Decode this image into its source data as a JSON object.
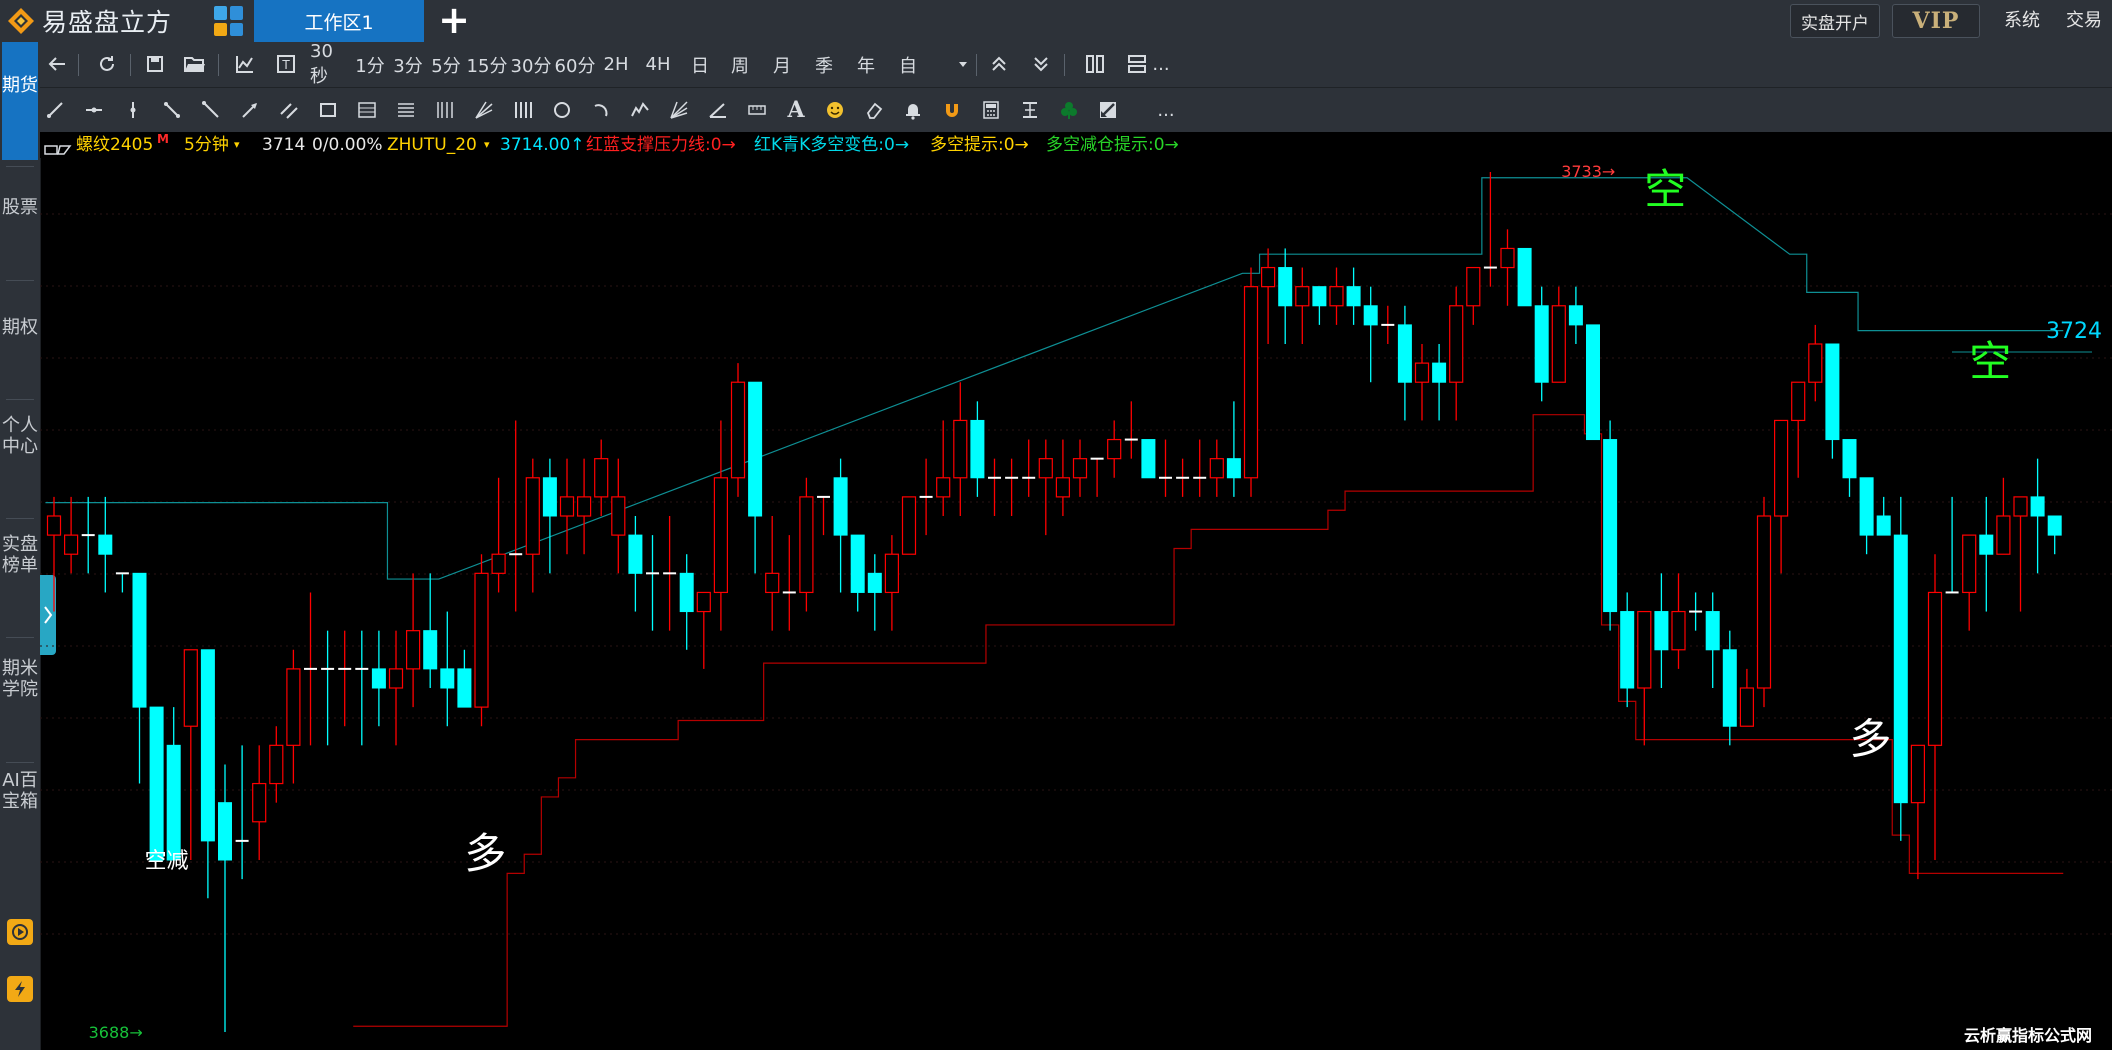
{
  "titlebar": {
    "app_name": "易盛盘立方",
    "workspace_tab": "工作区1",
    "add_tab": "+",
    "open_account": "实盘开户",
    "vip": "VIP",
    "system": "系统",
    "trade": "交易"
  },
  "sidebar": {
    "items": [
      {
        "label": "期货",
        "active": true
      },
      {
        "label": "股票"
      },
      {
        "label": "期权"
      },
      {
        "label": "个人中心"
      },
      {
        "label": "实盘榜单"
      },
      {
        "label": "期米学院"
      },
      {
        "label": "AI百宝箱"
      }
    ]
  },
  "toolbar1": {
    "icons": [
      "back-icon",
      "refresh-icon",
      "save-icon",
      "open-folder-icon",
      "indicator-icon",
      "text-icon"
    ],
    "periods": [
      "30秒",
      "1分",
      "3分",
      "5分",
      "15分",
      "30分",
      "60分",
      "2H",
      "4H",
      "日",
      "周",
      "月",
      "季",
      "年",
      "自"
    ],
    "more": "..."
  },
  "toolbar2": {
    "drawing_tools": [
      "line-icon",
      "horizontal-segment-icon",
      "vertical-line-icon",
      "trend-line-icon",
      "segment-icon",
      "arrow-line-icon",
      "parallel-lines-icon",
      "rectangle-icon",
      "gann-box-icon",
      "fib-retracement-icon",
      "fib-timezone-icon",
      "fib-fan-icon",
      "period-lines-icon",
      "circle-icon",
      "arc-icon",
      "wave-icon",
      "speed-fan-icon",
      "angle-icon",
      "ruler-icon",
      "text-tool-icon",
      "emoji-icon",
      "eraser-icon",
      "alarm-bell-icon",
      "magnet-icon",
      "calculator-icon",
      "price-range-icon",
      "clover-icon",
      "hide-drawings-icon"
    ],
    "text_tool_glyph": "A",
    "more": "..."
  },
  "infobar": {
    "symbol": "螺纹2405",
    "main_mark": "M",
    "period": "5分钟",
    "price": "3714",
    "change": "0/0.00%",
    "indicator": "ZHUTU_20",
    "ind_value": "3714.00↑",
    "line1": "红蓝支撑压力线:0→",
    "line2": "红K青K多空变色:0→",
    "line3": "多空提示:0→",
    "line4": "多空减仓提示:0→"
  },
  "chart_data": {
    "type": "candlestick",
    "symbol": "螺纹2405",
    "period": "5分钟",
    "ylim": [
      3688,
      3733
    ],
    "candles": [
      {
        "o": 3714,
        "h": 3716,
        "l": 3710,
        "c": 3715,
        "u": false
      },
      {
        "o": 3713,
        "h": 3716,
        "l": 3712,
        "c": 3714,
        "u": false
      },
      {
        "o": 3714,
        "h": 3716,
        "l": 3712,
        "c": 3714,
        "u": false
      },
      {
        "o": 3714,
        "h": 3716,
        "l": 3711,
        "c": 3713,
        "u": false
      },
      {
        "o": 3712,
        "h": 3712,
        "l": 3711,
        "c": 3712,
        "u": false
      },
      {
        "o": 3712,
        "h": 3712,
        "l": 3701,
        "c": 3705,
        "u": false
      },
      {
        "o": 3705,
        "h": 3705,
        "l": 3697,
        "c": 3697,
        "u": false
      },
      {
        "o": 3703,
        "h": 3705,
        "l": 3697,
        "c": 3697,
        "u": false
      },
      {
        "o": 3704,
        "h": 3708,
        "l": 3697,
        "c": 3708,
        "u": false
      },
      {
        "o": 3708,
        "h": 3708,
        "l": 3695,
        "c": 3698,
        "u": false
      },
      {
        "o": 3700,
        "h": 3702,
        "l": 3688,
        "c": 3697,
        "u": false
      },
      {
        "o": 3698,
        "h": 3703,
        "l": 3696,
        "c": 3698,
        "u": false
      },
      {
        "o": 3699,
        "h": 3703,
        "l": 3697,
        "c": 3701,
        "u": false
      },
      {
        "o": 3701,
        "h": 3704,
        "l": 3700,
        "c": 3703,
        "u": false
      },
      {
        "o": 3703,
        "h": 3708,
        "l": 3701,
        "c": 3707,
        "u": false
      },
      {
        "o": 3707,
        "h": 3711,
        "l": 3703,
        "c": 3707,
        "u": true
      },
      {
        "o": 3707,
        "h": 3709,
        "l": 3703,
        "c": 3707,
        "u": false
      },
      {
        "o": 3707,
        "h": 3709,
        "l": 3704,
        "c": 3707,
        "u": true
      },
      {
        "o": 3707,
        "h": 3709,
        "l": 3703,
        "c": 3707,
        "u": false
      },
      {
        "o": 3707,
        "h": 3709,
        "l": 3704,
        "c": 3706,
        "u": false
      },
      {
        "o": 3706,
        "h": 3709,
        "l": 3703,
        "c": 3707,
        "u": true
      },
      {
        "o": 3707,
        "h": 3712,
        "l": 3705,
        "c": 3709,
        "u": true
      },
      {
        "o": 3709,
        "h": 3712,
        "l": 3706,
        "c": 3707,
        "u": false
      },
      {
        "o": 3707,
        "h": 3710,
        "l": 3704,
        "c": 3706,
        "u": false
      },
      {
        "o": 3707,
        "h": 3708,
        "l": 3705,
        "c": 3705,
        "u": false
      },
      {
        "o": 3705,
        "h": 3713,
        "l": 3704,
        "c": 3712,
        "u": true
      },
      {
        "o": 3712,
        "h": 3717,
        "l": 3711,
        "c": 3713,
        "u": true
      },
      {
        "o": 3713,
        "h": 3720,
        "l": 3710,
        "c": 3713,
        "u": true
      },
      {
        "o": 3713,
        "h": 3718,
        "l": 3711,
        "c": 3717,
        "u": true
      },
      {
        "o": 3717,
        "h": 3718,
        "l": 3712,
        "c": 3715,
        "u": false
      },
      {
        "o": 3715,
        "h": 3718,
        "l": 3713,
        "c": 3716,
        "u": true
      },
      {
        "o": 3715,
        "h": 3718,
        "l": 3713,
        "c": 3716,
        "u": true
      },
      {
        "o": 3716,
        "h": 3719,
        "l": 3715,
        "c": 3718,
        "u": true
      },
      {
        "o": 3714,
        "h": 3718,
        "l": 3712,
        "c": 3716,
        "u": true
      },
      {
        "o": 3714,
        "h": 3715,
        "l": 3710,
        "c": 3712,
        "u": false
      },
      {
        "o": 3712,
        "h": 3714,
        "l": 3709,
        "c": 3712,
        "u": false
      },
      {
        "o": 3712,
        "h": 3715,
        "l": 3709,
        "c": 3712,
        "u": true
      },
      {
        "o": 3712,
        "h": 3713,
        "l": 3708,
        "c": 3710,
        "u": false
      },
      {
        "o": 3710,
        "h": 3711,
        "l": 3707,
        "c": 3711,
        "u": true
      },
      {
        "o": 3711,
        "h": 3720,
        "l": 3709,
        "c": 3717,
        "u": true
      },
      {
        "o": 3717,
        "h": 3723,
        "l": 3716,
        "c": 3722,
        "u": true
      },
      {
        "o": 3722,
        "h": 3722,
        "l": 3712,
        "c": 3715,
        "u": false
      },
      {
        "o": 3711,
        "h": 3715,
        "l": 3709,
        "c": 3712,
        "u": true
      },
      {
        "o": 3711,
        "h": 3714,
        "l": 3709,
        "c": 3711,
        "u": true
      },
      {
        "o": 3711,
        "h": 3717,
        "l": 3710,
        "c": 3716,
        "u": true
      },
      {
        "o": 3716,
        "h": 3716,
        "l": 3714,
        "c": 3716,
        "u": true
      },
      {
        "o": 3717,
        "h": 3718,
        "l": 3711,
        "c": 3714,
        "u": false
      },
      {
        "o": 3714,
        "h": 3714,
        "l": 3710,
        "c": 3711,
        "u": false
      },
      {
        "o": 3712,
        "h": 3713,
        "l": 3709,
        "c": 3711,
        "u": false
      },
      {
        "o": 3711,
        "h": 3714,
        "l": 3709,
        "c": 3713,
        "u": true
      },
      {
        "o": 3713,
        "h": 3716,
        "l": 3713,
        "c": 3716,
        "u": true
      },
      {
        "o": 3716,
        "h": 3718,
        "l": 3714,
        "c": 3716,
        "u": true
      },
      {
        "o": 3716,
        "h": 3720,
        "l": 3715,
        "c": 3717,
        "u": true
      },
      {
        "o": 3717,
        "h": 3722,
        "l": 3715,
        "c": 3720,
        "u": true
      },
      {
        "o": 3720,
        "h": 3721,
        "l": 3716,
        "c": 3717,
        "u": false
      },
      {
        "o": 3717,
        "h": 3718,
        "l": 3715,
        "c": 3717,
        "u": true
      },
      {
        "o": 3717,
        "h": 3718,
        "l": 3715,
        "c": 3717,
        "u": true
      },
      {
        "o": 3717,
        "h": 3719,
        "l": 3716,
        "c": 3717,
        "u": true
      },
      {
        "o": 3717,
        "h": 3719,
        "l": 3714,
        "c": 3718,
        "u": true
      },
      {
        "o": 3716,
        "h": 3719,
        "l": 3715,
        "c": 3717,
        "u": true
      },
      {
        "o": 3717,
        "h": 3719,
        "l": 3716,
        "c": 3718,
        "u": true
      },
      {
        "o": 3718,
        "h": 3718,
        "l": 3716,
        "c": 3718,
        "u": true
      },
      {
        "o": 3718,
        "h": 3720,
        "l": 3717,
        "c": 3719,
        "u": true
      },
      {
        "o": 3719,
        "h": 3721,
        "l": 3718,
        "c": 3719,
        "u": true
      },
      {
        "o": 3719,
        "h": 3719,
        "l": 3717,
        "c": 3717,
        "u": false
      },
      {
        "o": 3717,
        "h": 3719,
        "l": 3716,
        "c": 3717,
        "u": true
      },
      {
        "o": 3717,
        "h": 3718,
        "l": 3716,
        "c": 3717,
        "u": true
      },
      {
        "o": 3717,
        "h": 3719,
        "l": 3716,
        "c": 3717,
        "u": true
      },
      {
        "o": 3717,
        "h": 3719,
        "l": 3716,
        "c": 3718,
        "u": true
      },
      {
        "o": 3718,
        "h": 3721,
        "l": 3716,
        "c": 3717,
        "u": false
      },
      {
        "o": 3717,
        "h": 3728,
        "l": 3716,
        "c": 3727,
        "u": true
      },
      {
        "o": 3727,
        "h": 3729,
        "l": 3724,
        "c": 3728,
        "u": true
      },
      {
        "o": 3728,
        "h": 3729,
        "l": 3724,
        "c": 3726,
        "u": false
      },
      {
        "o": 3726,
        "h": 3728,
        "l": 3724,
        "c": 3727,
        "u": true
      },
      {
        "o": 3727,
        "h": 3727,
        "l": 3725,
        "c": 3726,
        "u": false
      },
      {
        "o": 3726,
        "h": 3728,
        "l": 3725,
        "c": 3727,
        "u": true
      },
      {
        "o": 3727,
        "h": 3728,
        "l": 3725,
        "c": 3726,
        "u": false
      },
      {
        "o": 3726,
        "h": 3727,
        "l": 3722,
        "c": 3725,
        "u": false
      },
      {
        "o": 3725,
        "h": 3726,
        "l": 3724,
        "c": 3725,
        "u": true
      },
      {
        "o": 3725,
        "h": 3726,
        "l": 3720,
        "c": 3722,
        "u": false
      },
      {
        "o": 3722,
        "h": 3724,
        "l": 3720,
        "c": 3723,
        "u": true
      },
      {
        "o": 3723,
        "h": 3724,
        "l": 3720,
        "c": 3722,
        "u": false
      },
      {
        "o": 3722,
        "h": 3727,
        "l": 3720,
        "c": 3726,
        "u": true
      },
      {
        "o": 3726,
        "h": 3728,
        "l": 3725,
        "c": 3728,
        "u": true
      },
      {
        "o": 3728,
        "h": 3733,
        "l": 3727,
        "c": 3728,
        "u": true
      },
      {
        "o": 3728,
        "h": 3730,
        "l": 3726,
        "c": 3729,
        "u": true
      },
      {
        "o": 3729,
        "h": 3729,
        "l": 3726,
        "c": 3726,
        "u": false
      },
      {
        "o": 3726,
        "h": 3727,
        "l": 3721,
        "c": 3722,
        "u": false
      },
      {
        "o": 3722,
        "h": 3727,
        "l": 3722,
        "c": 3726,
        "u": true
      },
      {
        "o": 3726,
        "h": 3727,
        "l": 3724,
        "c": 3725,
        "u": false
      },
      {
        "o": 3725,
        "h": 3725,
        "l": 3719,
        "c": 3719,
        "u": false
      },
      {
        "o": 3719,
        "h": 3720,
        "l": 3709,
        "c": 3710,
        "u": false
      },
      {
        "o": 3710,
        "h": 3711,
        "l": 3705,
        "c": 3706,
        "u": false
      },
      {
        "o": 3706,
        "h": 3710,
        "l": 3703,
        "c": 3710,
        "u": false
      },
      {
        "o": 3710,
        "h": 3712,
        "l": 3706,
        "c": 3708,
        "u": false
      },
      {
        "o": 3708,
        "h": 3712,
        "l": 3707,
        "c": 3710,
        "u": false
      },
      {
        "o": 3710,
        "h": 3711,
        "l": 3709,
        "c": 3710,
        "u": false
      },
      {
        "o": 3710,
        "h": 3711,
        "l": 3706,
        "c": 3708,
        "u": false
      },
      {
        "o": 3708,
        "h": 3709,
        "l": 3703,
        "c": 3704,
        "u": false
      },
      {
        "o": 3704,
        "h": 3707,
        "l": 3704,
        "c": 3706,
        "u": false
      },
      {
        "o": 3706,
        "h": 3716,
        "l": 3705,
        "c": 3715,
        "u": true
      },
      {
        "o": 3715,
        "h": 3720,
        "l": 3712,
        "c": 3720,
        "u": true
      },
      {
        "o": 3720,
        "h": 3721,
        "l": 3717,
        "c": 3722,
        "u": true
      },
      {
        "o": 3722,
        "h": 3725,
        "l": 3721,
        "c": 3724,
        "u": true
      },
      {
        "o": 3724,
        "h": 3722,
        "l": 3718,
        "c": 3719,
        "u": false
      },
      {
        "o": 3719,
        "h": 3719,
        "l": 3716,
        "c": 3717,
        "u": false
      },
      {
        "o": 3717,
        "h": 3717,
        "l": 3713,
        "c": 3714,
        "u": false
      },
      {
        "o": 3715,
        "h": 3716,
        "l": 3714,
        "c": 3714,
        "u": false
      },
      {
        "o": 3714,
        "h": 3716,
        "l": 3698,
        "c": 3700,
        "u": false
      },
      {
        "o": 3700,
        "h": 3703,
        "l": 3696,
        "c": 3703,
        "u": false
      },
      {
        "o": 3703,
        "h": 3713,
        "l": 3697,
        "c": 3711,
        "u": false
      },
      {
        "o": 3711,
        "h": 3716,
        "l": 3711,
        "c": 3711,
        "u": false
      },
      {
        "o": 3711,
        "h": 3714,
        "l": 3709,
        "c": 3714,
        "u": false
      },
      {
        "o": 3714,
        "h": 3716,
        "l": 3710,
        "c": 3713,
        "u": false
      },
      {
        "o": 3713,
        "h": 3717,
        "l": 3713,
        "c": 3715,
        "u": false
      },
      {
        "o": 3715,
        "h": 3716,
        "l": 3710,
        "c": 3716,
        "u": false
      },
      {
        "o": 3716,
        "h": 3718,
        "l": 3712,
        "c": 3715,
        "u": false
      },
      {
        "o": 3715,
        "h": 3715,
        "l": 3713,
        "c": 3714,
        "u": false
      }
    ],
    "price_labels": [
      {
        "text": "3733→",
        "value": 3733
      },
      {
        "text": "3688→",
        "value": 3688
      },
      {
        "text": "3724",
        "value": 3724
      }
    ],
    "annotations": [
      {
        "text": "多",
        "candle": 24,
        "value": 3697
      },
      {
        "text": "多",
        "candle": 105,
        "value": 3703
      },
      {
        "text": "空",
        "candle": 93,
        "value": 3731
      },
      {
        "text": "空",
        "candle": 112,
        "value": 3722
      },
      {
        "text": "空减",
        "candle": 6,
        "value": 3697
      }
    ],
    "colors": {
      "up": "#ff0000",
      "down": "#00ffff",
      "bg": "#000000",
      "support": "#b50000",
      "resist": "#0e8f94"
    }
  },
  "watermark": "云析赢指标公式网"
}
